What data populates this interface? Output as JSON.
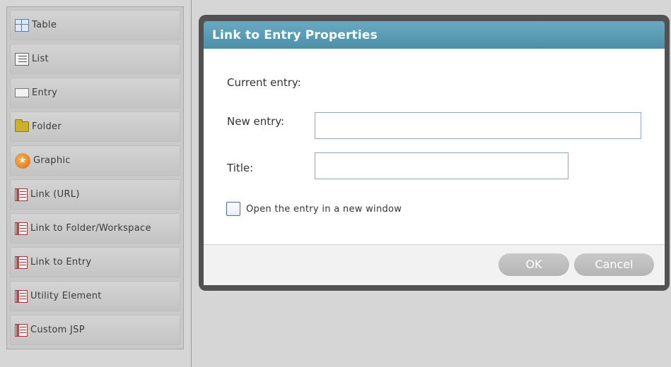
{
  "palette": {
    "items": [
      {
        "label": "Table",
        "icon": "table-icon"
      },
      {
        "label": "List",
        "icon": "list-icon"
      },
      {
        "label": "Entry",
        "icon": "entry-icon"
      },
      {
        "label": "Folder",
        "icon": "folder-icon"
      },
      {
        "label": "Graphic",
        "icon": "graphic-icon"
      },
      {
        "label": "Link (URL)",
        "icon": "link-url-icon"
      },
      {
        "label": "Link to Folder/Workspace",
        "icon": "link-folder-icon"
      },
      {
        "label": "Link to Entry",
        "icon": "link-entry-icon"
      },
      {
        "label": "Utility Element",
        "icon": "utility-element-icon"
      },
      {
        "label": "Custom JSP",
        "icon": "custom-jsp-icon"
      }
    ]
  },
  "dialog": {
    "title": "Link to Entry Properties",
    "current_entry_label": "Current entry:",
    "new_entry_label": "New entry:",
    "new_entry_value": "",
    "title_label": "Title:",
    "title_value": "",
    "open_new_window_label": "Open the entry in a new window",
    "open_new_window_checked": false,
    "ok_label": "OK",
    "cancel_label": "Cancel"
  },
  "colors": {
    "header": "#5b9bb5",
    "frame": "#525252",
    "button": "#bdbdbd",
    "background": "#d6d6d6"
  }
}
